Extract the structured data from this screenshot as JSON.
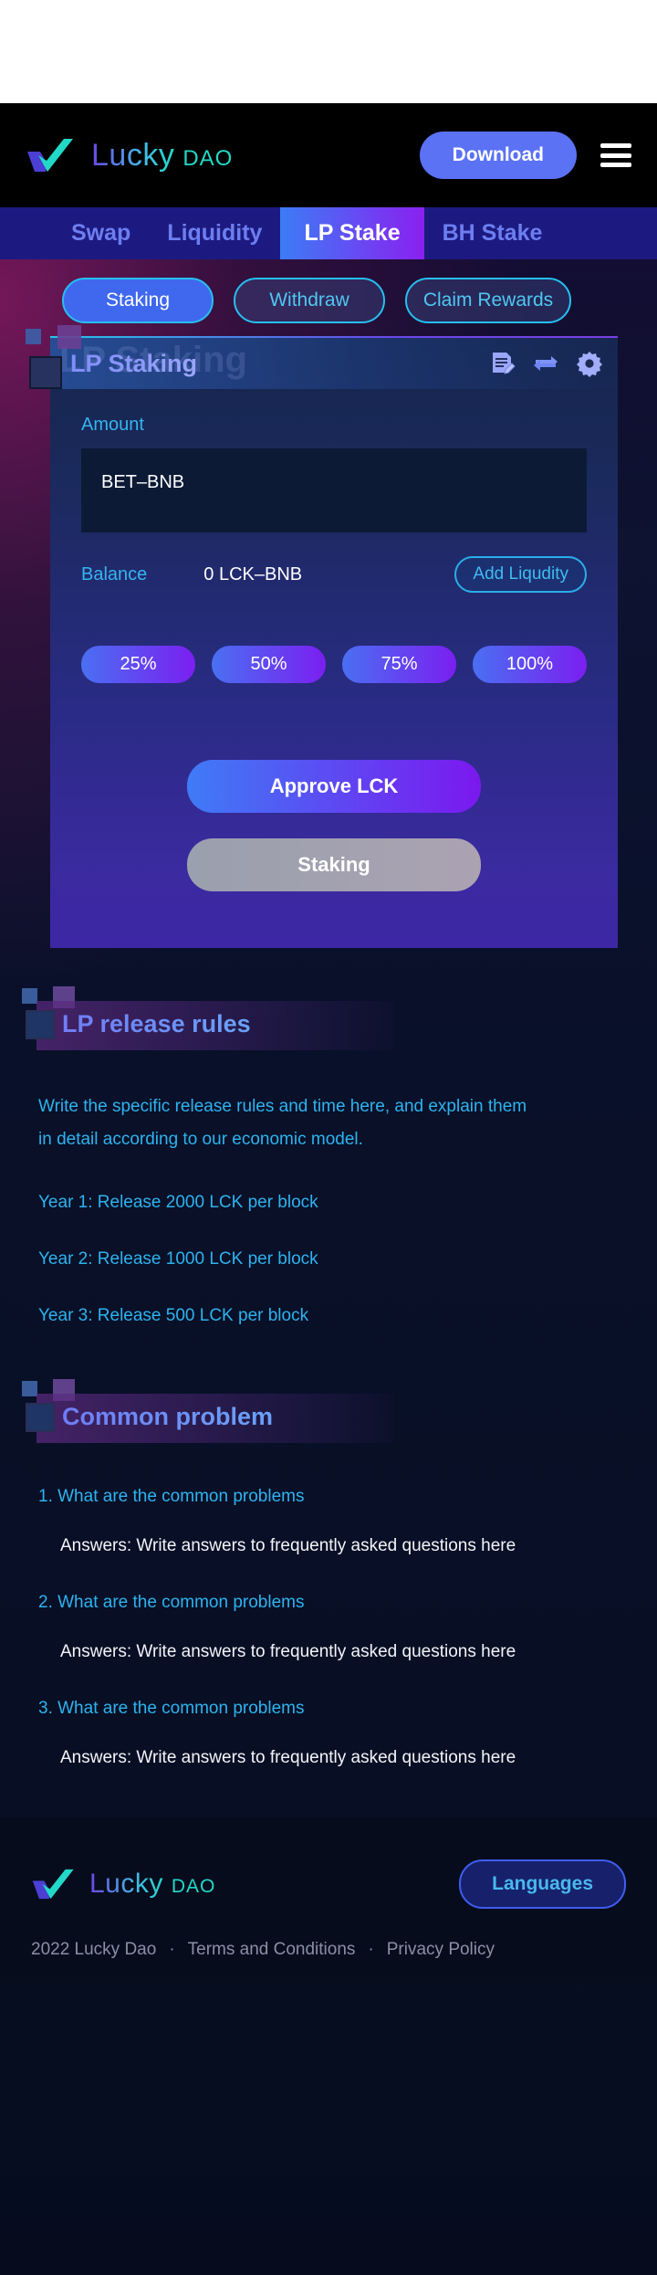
{
  "header": {
    "brand": {
      "lucky": "Lucky",
      "dao": "DAO",
      "check_icon": "check-mark-logo-icon"
    },
    "download_label": "Download",
    "menu_icon": "hamburger-menu-icon"
  },
  "nav": {
    "tabs": [
      {
        "label": "Swap",
        "active": false
      },
      {
        "label": "Liquidity",
        "active": false
      },
      {
        "label": "LP Stake",
        "active": true
      },
      {
        "label": "BH Stake",
        "active": false
      }
    ]
  },
  "modes": [
    {
      "label": "Staking",
      "active": true
    },
    {
      "label": "Withdraw",
      "active": false
    },
    {
      "label": "Claim Rewards",
      "active": false
    }
  ],
  "card": {
    "title": "LP Staking",
    "ghost_title": "LP Staking",
    "icons": [
      {
        "name": "document-edit-icon"
      },
      {
        "name": "swap-refresh-icon"
      },
      {
        "name": "gear-settings-icon"
      }
    ],
    "amount_label": "Amount",
    "amount_value": "BET–BNB",
    "amount_placeholder": "BET–BNB",
    "balance_label": "Balance",
    "balance_value": "0  LCK–BNB",
    "add_liquidity_label": "Add Liqudity",
    "percents": [
      "25%",
      "50%",
      "75%",
      "100%"
    ],
    "approve_label": "Approve LCK",
    "stake_label": "Staking"
  },
  "release": {
    "heading": "LP release rules",
    "paragraph": "Write the specific release rules and time here, and explain them in detail according to our economic model.",
    "rules": [
      "Year 1: Release 2000 LCK per block",
      "Year 2: Release 1000 LCK per block",
      "Year 3: Release 500 LCK per block"
    ]
  },
  "faq": {
    "heading": "Common problem",
    "items": [
      {
        "q": "1. What are the common problems",
        "a": "Answers: Write answers to frequently asked questions here"
      },
      {
        "q": "2. What are the common problems",
        "a": "Answers: Write answers to frequently asked questions here"
      },
      {
        "q": "3. What are the common problems",
        "a": "Answers: Write answers to frequently asked questions here"
      }
    ]
  },
  "footer": {
    "brand": {
      "lucky": "Lucky",
      "dao": "DAO"
    },
    "languages_label": "Languages",
    "copyright": "2022 Lucky Dao",
    "sep1": "·",
    "terms": "Terms and Conditions",
    "sep2": "·",
    "privacy": "Privacy Policy"
  },
  "colors": {
    "accent_blue": "#3c7cf6",
    "accent_purple": "#8b20f0",
    "cyan": "#2eb3ee",
    "nav_bg": "#1c1a80"
  }
}
